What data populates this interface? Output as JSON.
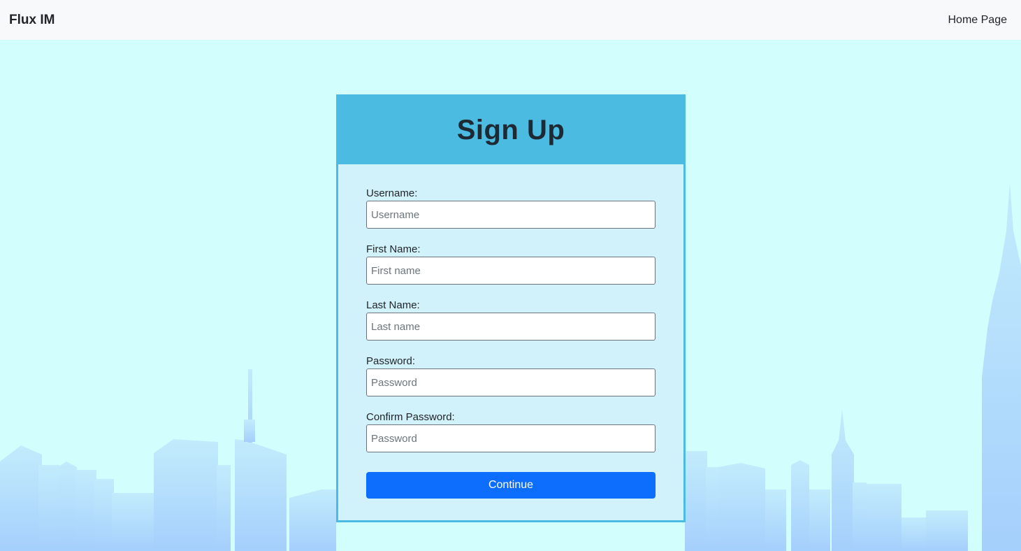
{
  "navbar": {
    "brand": "Flux IM",
    "link": "Home Page"
  },
  "form": {
    "title": "Sign Up",
    "fields": [
      {
        "label": "Username:",
        "placeholder": "Username",
        "value": ""
      },
      {
        "label": "First Name:",
        "placeholder": "First name",
        "value": ""
      },
      {
        "label": "Last Name:",
        "placeholder": "Last name",
        "value": ""
      },
      {
        "label": "Password:",
        "placeholder": "Password",
        "value": ""
      },
      {
        "label": "Confirm Password:",
        "placeholder": "Password",
        "value": ""
      }
    ],
    "submit_label": "Continue"
  },
  "colors": {
    "background": "#d2fffd",
    "skyline": "#a8d4fb",
    "card_header": "#4bbbe2",
    "card_body": "#d1f2fb",
    "button": "#0d6efd"
  }
}
